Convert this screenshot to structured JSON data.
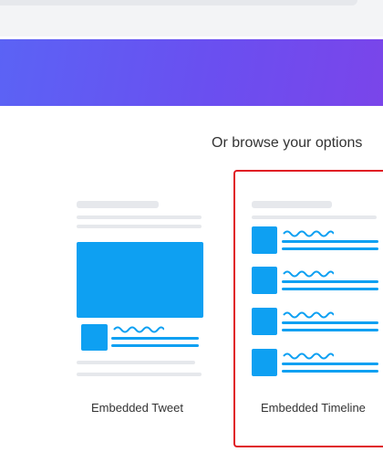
{
  "section": {
    "heading": "Or browse your options"
  },
  "options": [
    {
      "label": "Embedded Tweet",
      "selected": false
    },
    {
      "label": "Embedded Timeline",
      "selected": true
    }
  ],
  "colors": {
    "accent_blue": "#0ea0f2",
    "selection_border": "#e01b24",
    "banner_start": "#5b63f5",
    "banner_end": "#7a45ea"
  }
}
